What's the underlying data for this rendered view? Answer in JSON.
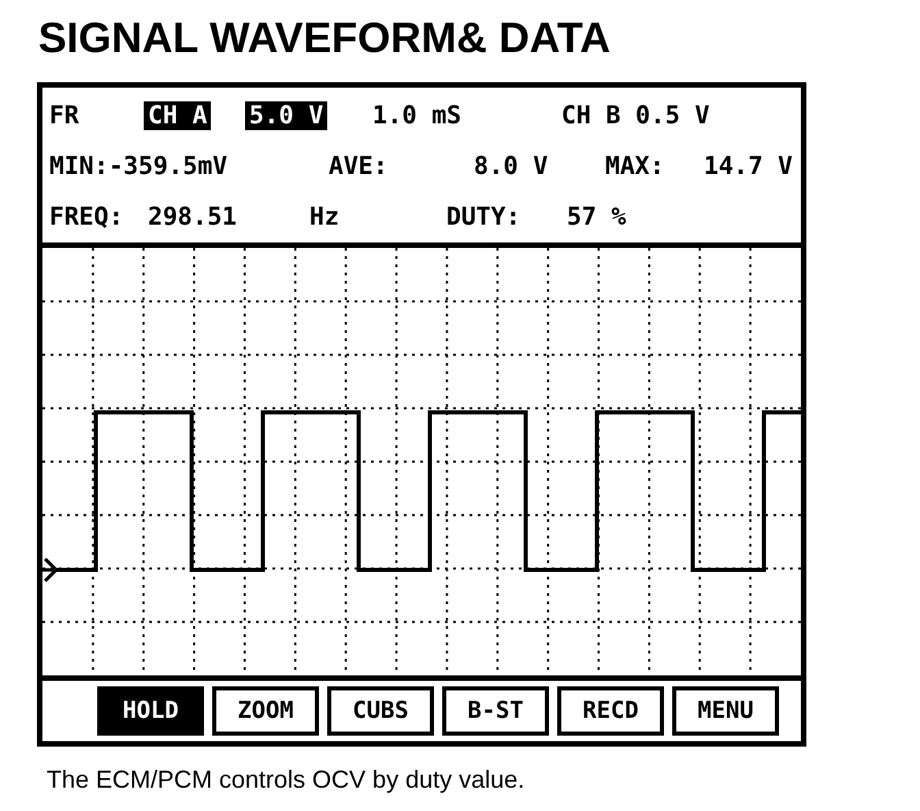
{
  "title": "SIGNAL WAVEFORM& DATA",
  "header_rows": [
    [
      {
        "text": "FR",
        "highlighted": false
      },
      {
        "text": "CH A",
        "highlighted": true
      },
      {
        "text": "5.0 V",
        "highlighted": true
      },
      {
        "text": "1.0 mS",
        "highlighted": false
      },
      {
        "text": "CH B 0.5 V",
        "highlighted": false
      }
    ],
    [
      {
        "text": "MIN:-359.5mV",
        "highlighted": false
      },
      {
        "text": "AVE:",
        "highlighted": false
      },
      {
        "text": "8.0 V",
        "highlighted": false
      },
      {
        "text": "MAX:",
        "highlighted": false
      },
      {
        "text": "14.7 V",
        "highlighted": false
      }
    ],
    [
      {
        "text": "FREQ:",
        "highlighted": false
      },
      {
        "text": "298.51",
        "highlighted": false
      },
      {
        "text": "Hz",
        "highlighted": false
      },
      {
        "text": "DUTY:",
        "highlighted": false
      },
      {
        "text": "57 %",
        "highlighted": false
      }
    ]
  ],
  "buttons": [
    {
      "label": "HOLD",
      "selected": true
    },
    {
      "label": "ZOOM",
      "selected": false
    },
    {
      "label": "CUBS",
      "selected": false
    },
    {
      "label": "B-ST",
      "selected": false
    },
    {
      "label": "RECD",
      "selected": false
    },
    {
      "label": "MENU",
      "selected": false
    }
  ],
  "caption": "The ECM/PCM controls OCV by duty value."
}
